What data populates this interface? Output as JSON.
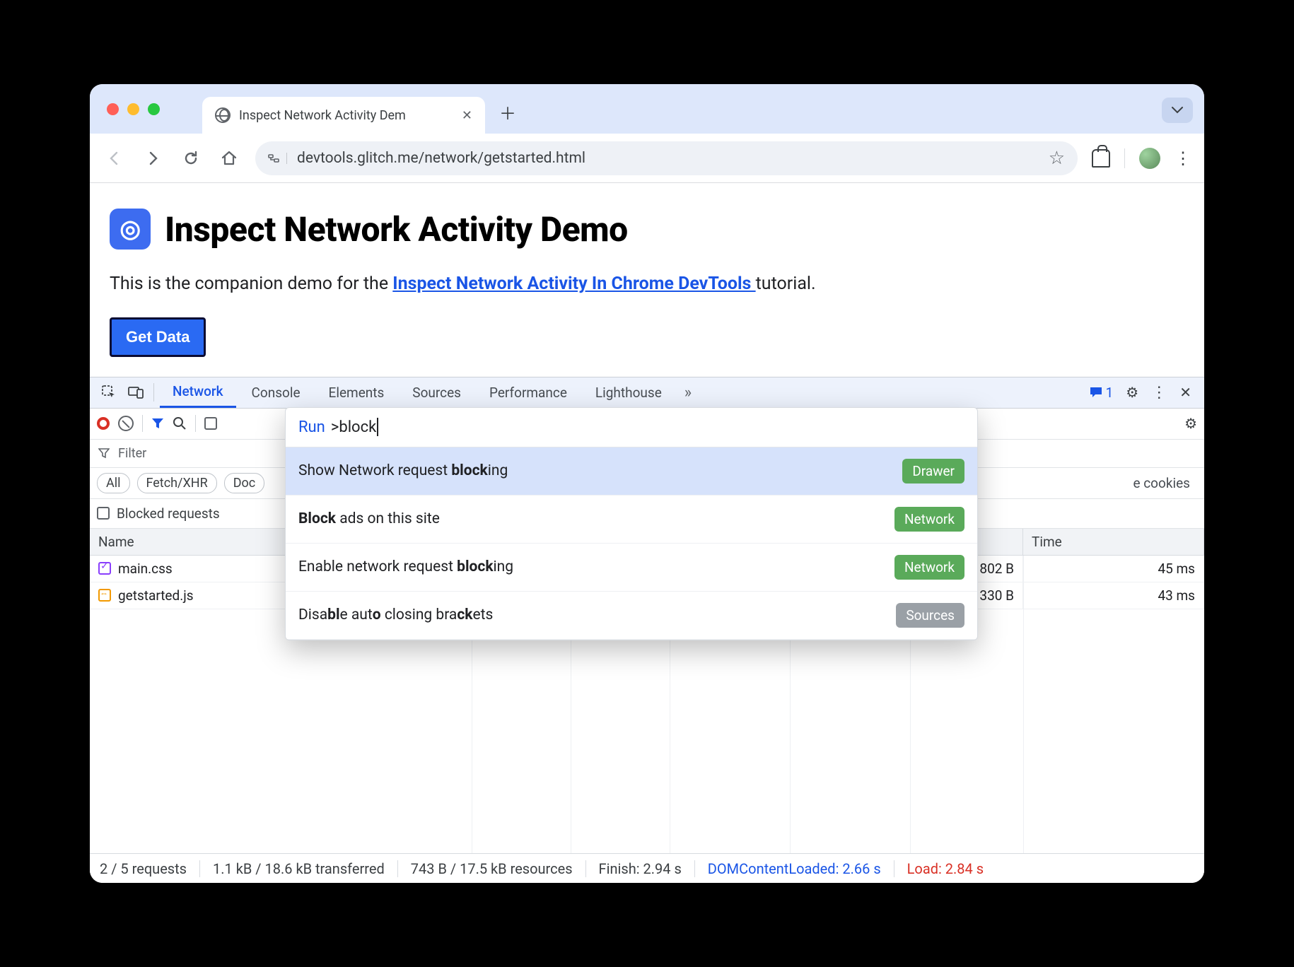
{
  "tab": {
    "title": "Inspect Network Activity Dem"
  },
  "omnibox": {
    "url": "devtools.glitch.me/network/getstarted.html"
  },
  "page": {
    "heading": "Inspect Network Activity Demo",
    "intro_before": "This is the companion demo for the ",
    "intro_link": "Inspect Network Activity In Chrome DevTools ",
    "intro_after": "tutorial.",
    "button": "Get Data"
  },
  "devtools": {
    "tabs": [
      "Network",
      "Console",
      "Elements",
      "Sources",
      "Performance",
      "Lighthouse"
    ],
    "issues_count": "1",
    "toolbar": {},
    "filter_placeholder": "Filter",
    "chips": [
      "All",
      "Fetch/XHR",
      "Doc"
    ],
    "chips_trail": "e cookies",
    "blocked_label": "Blocked requests",
    "command": {
      "prefix": "Run",
      "query": ">block",
      "items": [
        {
          "html": "Show Network request <b>block</b>ing",
          "badge": "Drawer",
          "badge_cls": "green",
          "selected": true
        },
        {
          "html": "<b>Block</b> ads on this site",
          "badge": "Network",
          "badge_cls": "green",
          "selected": false
        },
        {
          "html": "Enable network request <b>block</b>ing",
          "badge": "Network",
          "badge_cls": "green",
          "selected": false
        },
        {
          "html": "Disa<b>bl</b>e aut<b>o</b> closing bra<b>ck</b>ets",
          "badge": "Sources",
          "badge_cls": "gray",
          "selected": false
        }
      ]
    },
    "table": {
      "columns": [
        "Name",
        "",
        "",
        "",
        "",
        "",
        "Time"
      ],
      "rows": [
        {
          "name": "main.css",
          "icon": "css",
          "size": "802 B",
          "time": "45 ms"
        },
        {
          "name": "getstarted.js",
          "icon": "js",
          "size": "330 B",
          "time": "43 ms"
        }
      ]
    },
    "status": {
      "requests": "2 / 5 requests",
      "transferred": "1.1 kB / 18.6 kB transferred",
      "resources": "743 B / 17.5 kB resources",
      "finish": "Finish: 2.94 s",
      "dcl": "DOMContentLoaded: 2.66 s",
      "load": "Load: 2.84 s"
    }
  }
}
